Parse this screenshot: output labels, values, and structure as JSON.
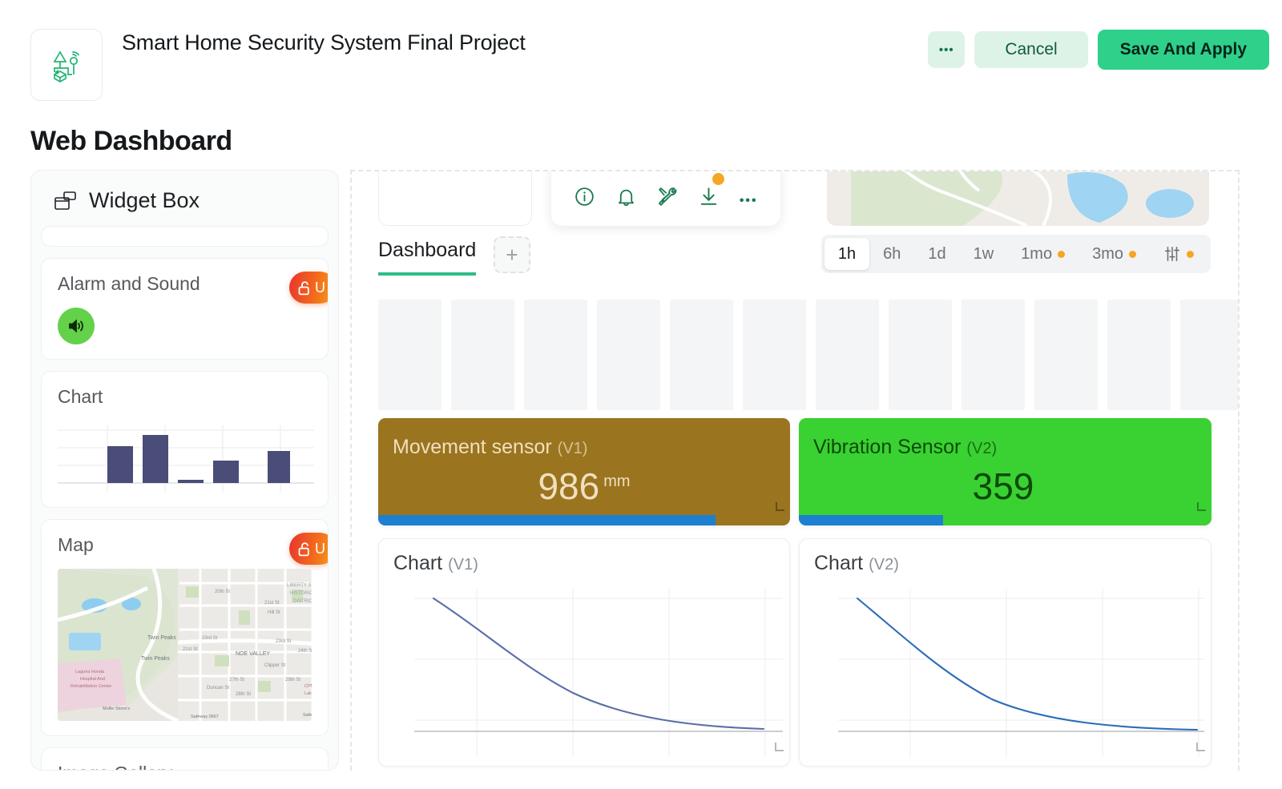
{
  "header": {
    "app_title": "Smart Home Security System Final Project",
    "logo_icon": "iot-device-icon",
    "more_label": "•••",
    "cancel_label": "Cancel",
    "save_label": "Save And Apply"
  },
  "page": {
    "title": "Web Dashboard"
  },
  "sidebar": {
    "title": "Widget Box",
    "title_icon": "widget-box-icon",
    "widgets": [
      {
        "label": "",
        "type": "clipped"
      },
      {
        "label": "Alarm and Sound",
        "locked": true,
        "lock_letter": "U",
        "icon": "speaker-icon"
      },
      {
        "label": "Chart",
        "locked": false,
        "icon": "bar-chart-icon"
      },
      {
        "label": "Map",
        "locked": true,
        "lock_letter": "U",
        "icon": "map-icon"
      },
      {
        "label": "Image Gallery",
        "locked": false,
        "icon": "gallery-icon"
      }
    ]
  },
  "canvas": {
    "toolbar": {
      "icons": [
        "info-icon",
        "bell-icon",
        "tools-icon",
        "download-icon",
        "more-icon"
      ],
      "download_badge": true
    },
    "tabs": {
      "active": "Dashboard",
      "add_label": "+"
    },
    "time_ranges": [
      {
        "label": "1h",
        "active": true,
        "dot": false
      },
      {
        "label": "6h",
        "active": false,
        "dot": false
      },
      {
        "label": "1d",
        "active": false,
        "dot": false
      },
      {
        "label": "1w",
        "active": false,
        "dot": false
      },
      {
        "label": "1mo",
        "active": false,
        "dot": true
      },
      {
        "label": "3mo",
        "active": false,
        "dot": true
      },
      {
        "label": "",
        "active": false,
        "dot": true,
        "icon": "sliders-icon"
      }
    ],
    "sensors": [
      {
        "name": "Movement sensor",
        "pin": "(V1)",
        "value": "986",
        "unit": "mm",
        "bg": "#9b7420",
        "fg": "#f0e0bd",
        "progress": 82,
        "progress_color": "#1c7fd0"
      },
      {
        "name": "Vibration Sensor",
        "pin": "(V2)",
        "value": "359",
        "unit": "",
        "bg": "#3ad132",
        "fg": "#0c4a08",
        "progress": 35,
        "progress_color": "#1c7fd0"
      }
    ],
    "charts": [
      {
        "name": "Chart",
        "pin": "(V1)"
      },
      {
        "name": "Chart",
        "pin": "(V2)"
      }
    ]
  },
  "chart_data": [
    {
      "type": "line",
      "title": "Chart (V1)",
      "x": [
        0,
        1,
        2,
        3,
        4,
        5,
        6,
        7,
        8,
        9,
        10
      ],
      "values": [
        100,
        78,
        60,
        46,
        35,
        26,
        19,
        14,
        10,
        7,
        5
      ],
      "xlabel": "",
      "ylabel": "",
      "ylim": [
        0,
        105
      ],
      "grid": true,
      "legend": "none",
      "line_color": "#5b6ea8"
    },
    {
      "type": "line",
      "title": "Chart (V2)",
      "x": [
        0,
        1,
        2,
        3,
        4,
        5,
        6,
        7,
        8,
        9,
        10
      ],
      "values": [
        100,
        74,
        55,
        40,
        29,
        21,
        15,
        11,
        8,
        6,
        4
      ],
      "xlabel": "",
      "ylabel": "",
      "ylim": [
        0,
        105
      ],
      "grid": true,
      "legend": "none",
      "line_color": "#2b6cb8"
    },
    {
      "type": "bar",
      "title": "Chart",
      "categories": [
        "1",
        "2",
        "3",
        "4",
        "5"
      ],
      "values": [
        62,
        82,
        6,
        37,
        55
      ],
      "xlabel": "",
      "ylabel": "",
      "ylim": [
        0,
        100
      ],
      "grid": true,
      "legend": "none",
      "bar_color": "#4a4d77"
    }
  ],
  "colors": {
    "accent_green": "#2fd08a",
    "tab_underline": "#2fbd87",
    "badge_orange": "#f5a623",
    "lock_gradient_from": "#e8342f",
    "lock_gradient_to": "#f7a41a",
    "progress_blue": "#1c7fd0"
  }
}
